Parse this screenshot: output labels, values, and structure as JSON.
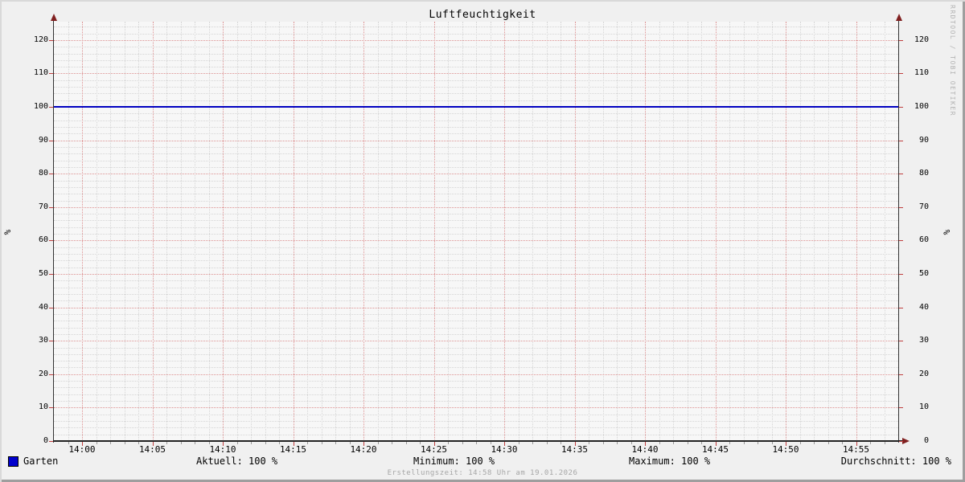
{
  "title": "Luftfeuchtigkeit",
  "watermark": "RRDTOOL / TOBI OETIKER",
  "axis": {
    "unit_left": "%",
    "unit_right": "%"
  },
  "legend": {
    "series_label": "Garten",
    "series_color": "#0000cc",
    "stats": [
      "Aktuell: 100 %",
      "Minimum: 100 %",
      "Maximum: 100 %",
      "Durchschnitt: 100 %"
    ]
  },
  "footer": "Erstellungszeit: 14:58 Uhr am 19.01.2026",
  "colors": {
    "background": "#f0f0f0",
    "canvas": "#f7f7f7",
    "major_grid": "#dd9292",
    "minor_grid": "#d5d5d5",
    "axis": "#333333",
    "arrow": "#802020",
    "line": "#0000c0",
    "watermark_text": "#b3b3b3",
    "footer_text": "#a6a6a6"
  },
  "chart_data": {
    "type": "line",
    "title": "Luftfeuchtigkeit",
    "xlabel": "",
    "ylabel": "%",
    "ylim": [
      0,
      125.5
    ],
    "y_major_step": 10,
    "y_minor_step": 2,
    "y_tick_labels": [
      "0",
      "10",
      "20",
      "30",
      "40",
      "50",
      "60",
      "70",
      "80",
      "90",
      "100",
      "110",
      "120"
    ],
    "x_range": [
      "13:58",
      "14:58"
    ],
    "x_total_minutes": 60,
    "x_first_label_offset_min": 2,
    "x_major_step_min": 5,
    "x_minor_step_min": 1,
    "x_tick_labels": [
      "14:00",
      "14:05",
      "14:10",
      "14:15",
      "14:20",
      "14:25",
      "14:30",
      "14:35",
      "14:40",
      "14:45",
      "14:50",
      "14:55"
    ],
    "grid": true,
    "legend_position": "bottom",
    "series": [
      {
        "name": "Garten",
        "color": "#0000c0",
        "x": [
          "14:00",
          "14:05",
          "14:10",
          "14:15",
          "14:20",
          "14:25",
          "14:30",
          "14:35",
          "14:40",
          "14:45",
          "14:50",
          "14:55"
        ],
        "values": [
          100,
          100,
          100,
          100,
          100,
          100,
          100,
          100,
          100,
          100,
          100,
          100
        ],
        "stats": {
          "aktuell": 100,
          "minimum": 100,
          "maximum": 100,
          "durchschnitt": 100
        }
      }
    ]
  }
}
